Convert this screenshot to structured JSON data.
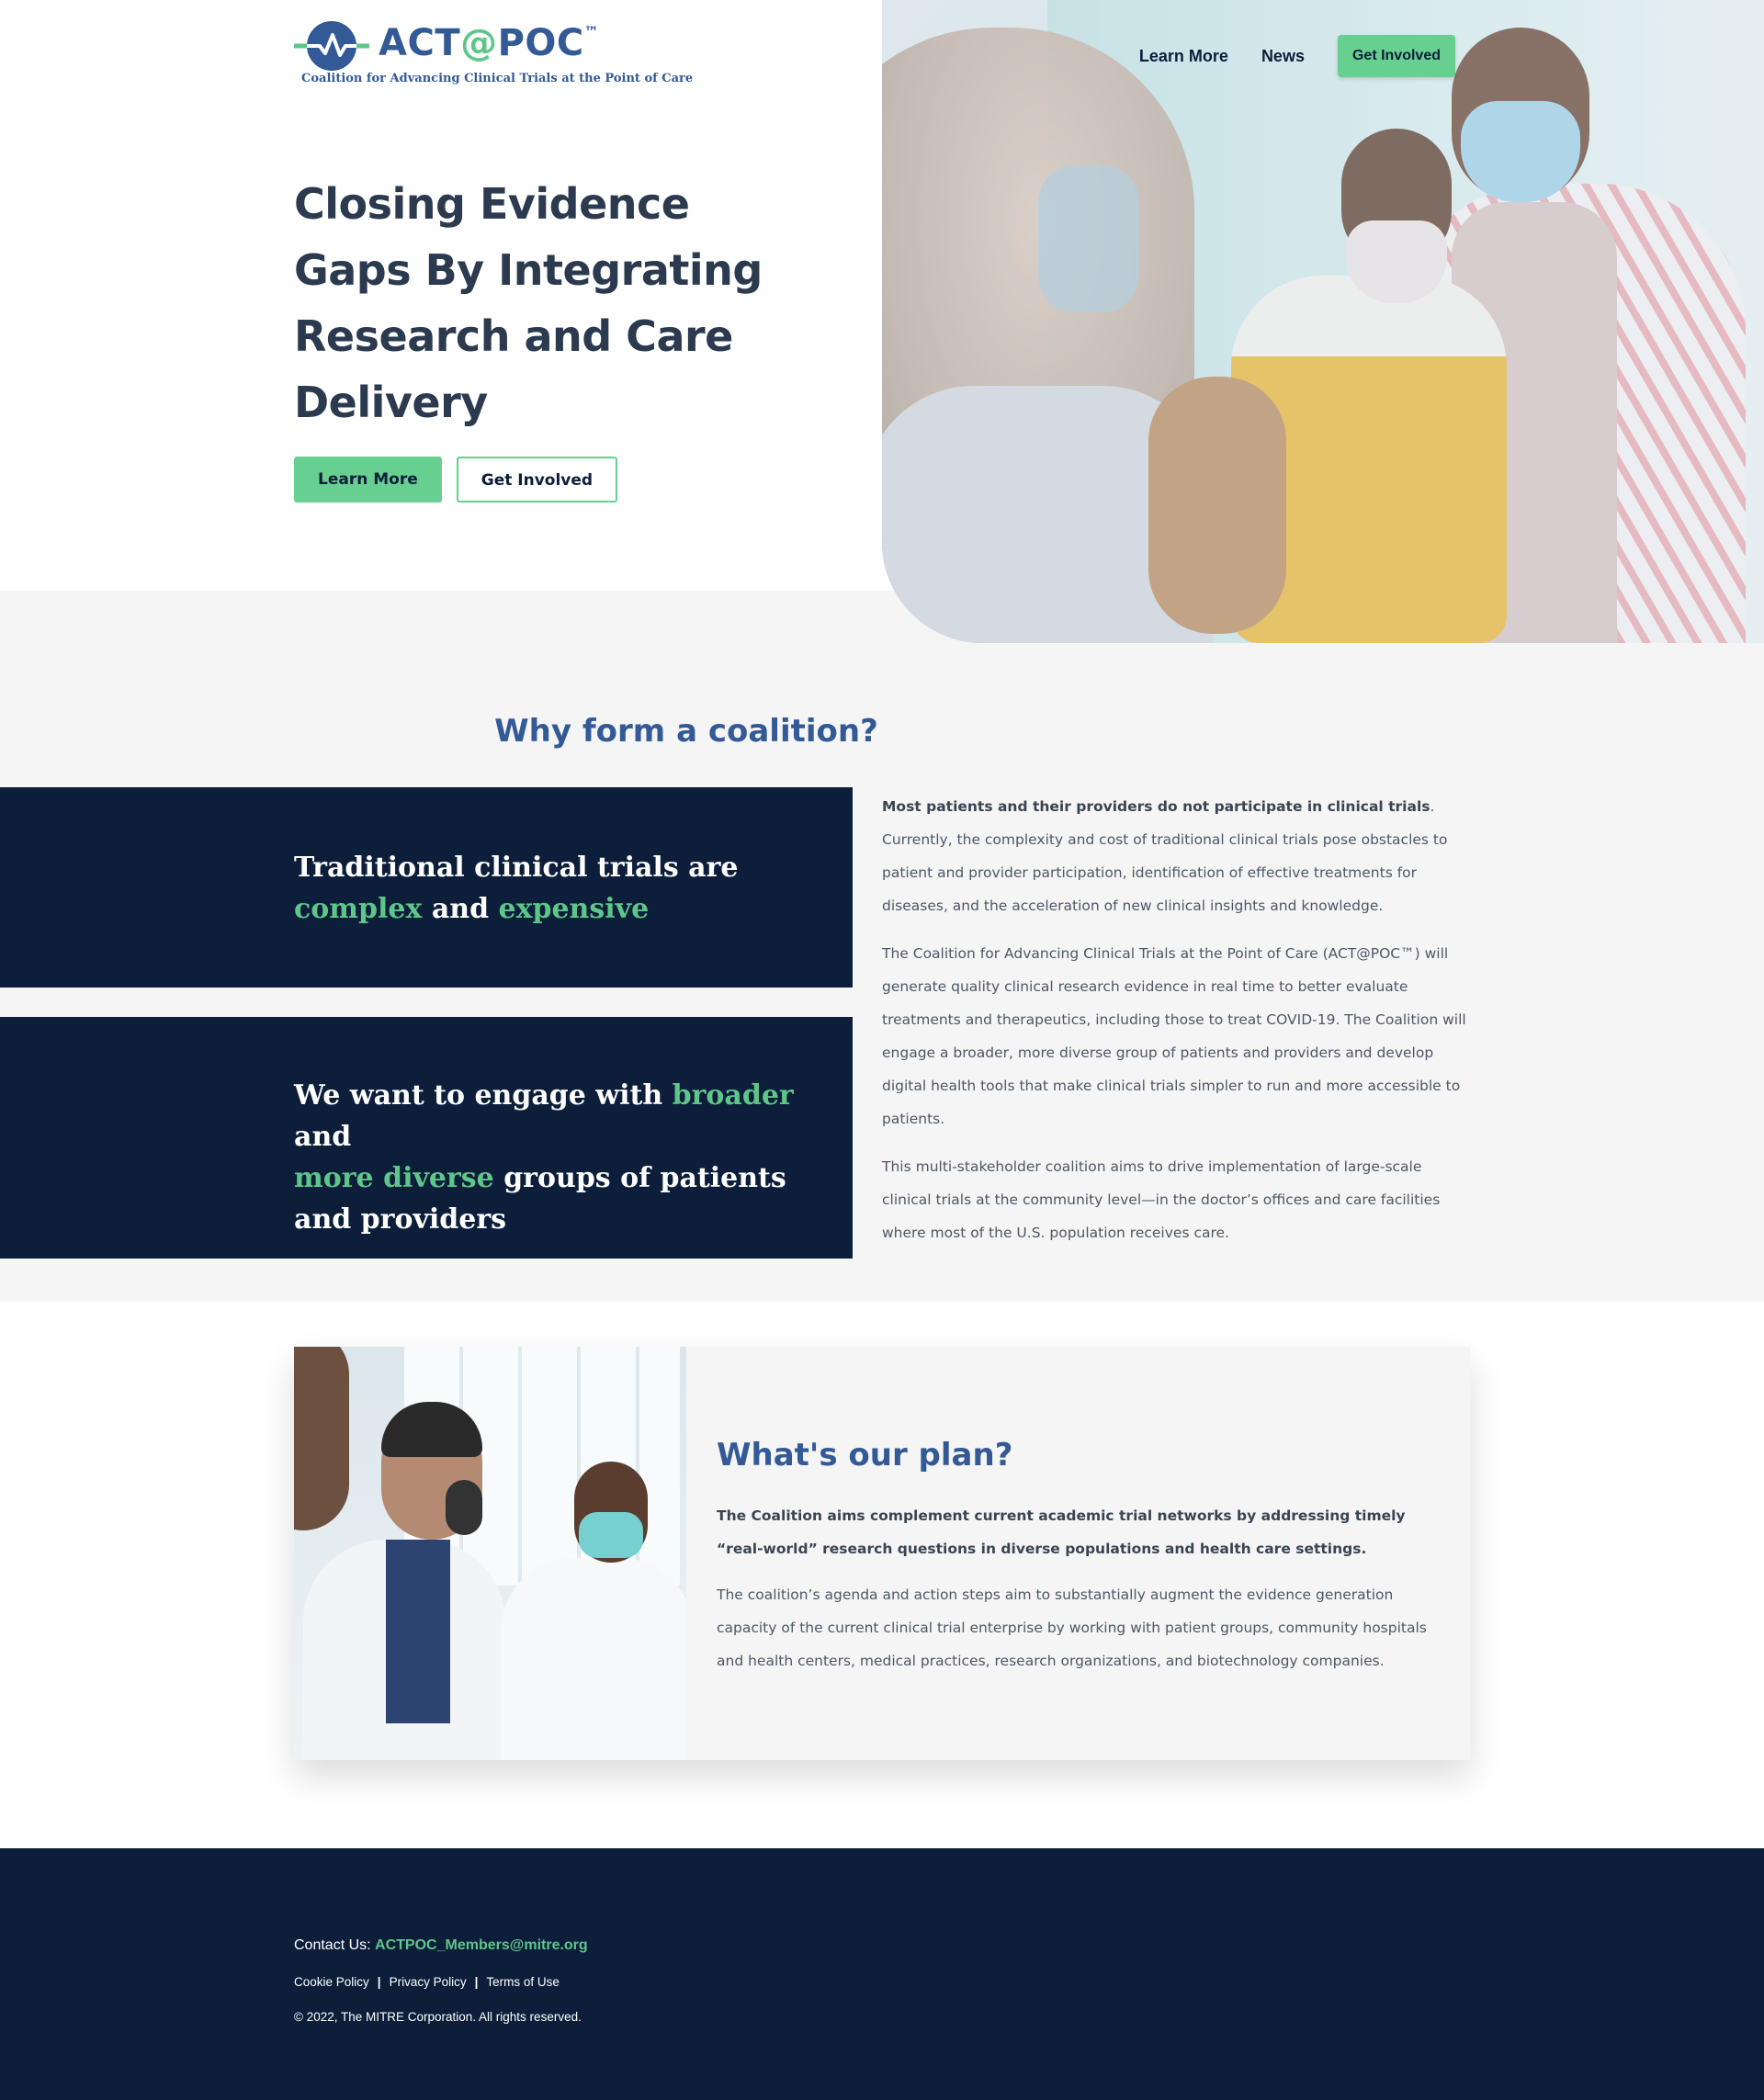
{
  "brand": {
    "name_part1": "ACT",
    "name_at": "@",
    "name_part2": "POC",
    "trademark": "™",
    "tagline": "Coalition for Advancing Clinical Trials at the Point of Care",
    "logo_icon": "heartbeat-circle-icon"
  },
  "nav": {
    "items": [
      {
        "label": "Learn More"
      },
      {
        "label": "News"
      }
    ],
    "cta_label": "Get Involved"
  },
  "hero": {
    "title": "Closing Evidence Gaps By Integrating Research and Care Delivery",
    "primary_button": "Learn More",
    "secondary_button": "Get Involved"
  },
  "coalition": {
    "title": "Why form a coalition?",
    "box1": {
      "text_a": "Traditional clinical trials are ",
      "highlight_a": "complex",
      "text_b": " and ",
      "highlight_b": "expensive"
    },
    "box2": {
      "text_a": "We want to engage with ",
      "highlight_a": "broader",
      "text_b": " and ",
      "highlight_b": "more diverse",
      "text_c": " groups of patients and providers"
    },
    "p1_bold": "Most patients and their providers do not participate in clinical trials",
    "p1_rest": ". Currently, the complexity and cost of traditional clinical trials pose obstacles to patient and provider participation, identification of effective treatments for diseases, and the acceleration of new clinical insights and knowledge.",
    "p2": "The Coalition for Advancing Clinical Trials at the Point of Care (ACT@POC™) will generate quality clinical research evidence in real time to better evaluate treatments and therapeutics, including those to treat COVID-19. The Coalition will engage a broader, more diverse group of patients and providers and develop digital health tools that make clinical trials simpler to run and more accessible to patients.",
    "p3": "This multi-stakeholder coalition aims to drive implementation of large-scale clinical trials at the community level—in the doctor’s offices and care facilities where most of the U.S. population receives care."
  },
  "plan": {
    "title": "What's our plan?",
    "lead": "The Coalition aims complement current academic trial networks by addressing timely “real-world” research questions in diverse populations and health care settings.",
    "body": "The coalition’s agenda and action steps aim to substantially augment the evidence generation capacity of the current clinical trial enterprise by working with patient groups, community hospitals and health centers, medical practices, research organizations, and biotechnology companies."
  },
  "footer": {
    "contact_label": "Contact Us: ",
    "contact_email": "ACTPOC_Members@mitre.org",
    "links": [
      "Cookie Policy",
      "Privacy Policy",
      "Terms of Use"
    ],
    "separator": "|",
    "copyright": "© 2022, The MITRE Corporation. All rights reserved."
  },
  "colors": {
    "navy": "#0c1e3a",
    "brand_blue": "#335a96",
    "accent_green": "#67cf8f",
    "panel_grey": "#f5f5f5"
  }
}
